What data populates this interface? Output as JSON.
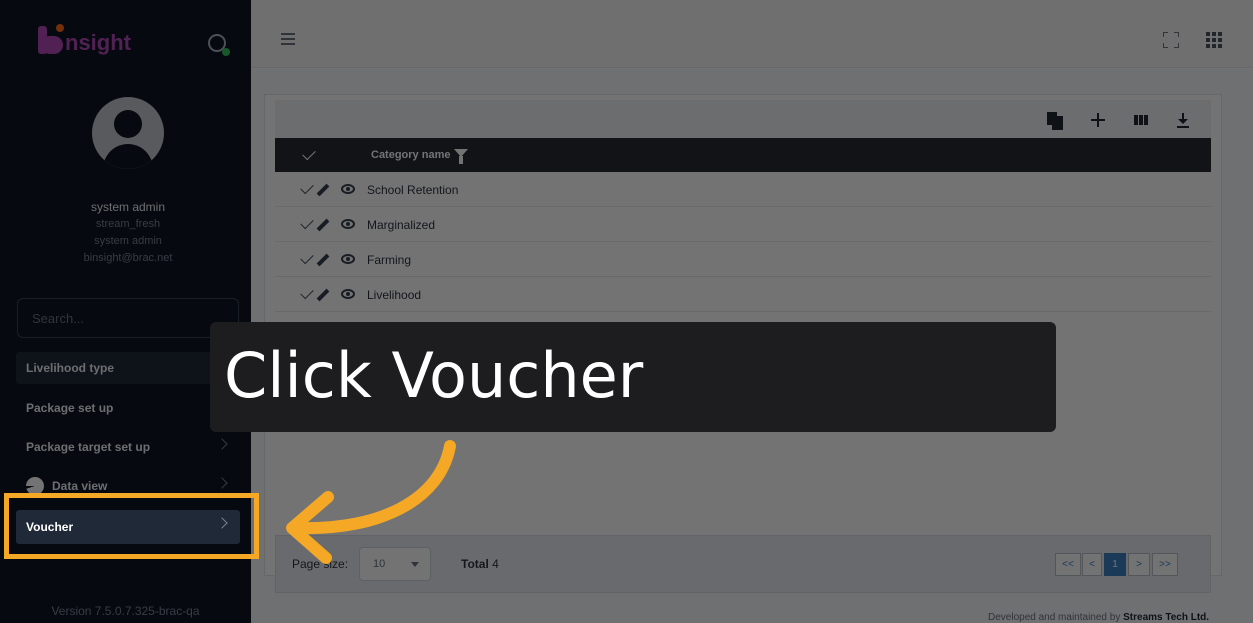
{
  "brand": {
    "name": "nsight"
  },
  "user": {
    "name": "system admin",
    "username": "stream_fresh",
    "role": "system admin",
    "email": "binsight@brac.net"
  },
  "sidebar": {
    "search_placeholder": "Search...",
    "items": [
      {
        "label": "Livelihood type"
      },
      {
        "label": "Package set up"
      },
      {
        "label": "Package target set up"
      },
      {
        "label": "Data view"
      },
      {
        "label": "Voucher"
      }
    ],
    "version": "Version 7.5.0.7.325-brac-qa"
  },
  "table": {
    "column_header": "Category name",
    "rows": [
      {
        "name": "School Retention"
      },
      {
        "name": "Marginalized"
      },
      {
        "name": "Farming"
      },
      {
        "name": "Livelihood"
      }
    ]
  },
  "pagination": {
    "page_size_label": "Page size:",
    "page_size": "10",
    "total_label": "Total",
    "total_count": "4",
    "first": "<<",
    "prev": "<",
    "current": "1",
    "next": ">",
    "last": ">>"
  },
  "footer": {
    "prefix": "Developed and maintained by",
    "company": "Streams Tech Ltd."
  },
  "callout": {
    "text": "Click Voucher"
  },
  "colors": {
    "sidebar_bg": "#0e1624",
    "highlight": "#f4a825",
    "accent": "#3b82c4",
    "brand": "#b24bb7"
  }
}
